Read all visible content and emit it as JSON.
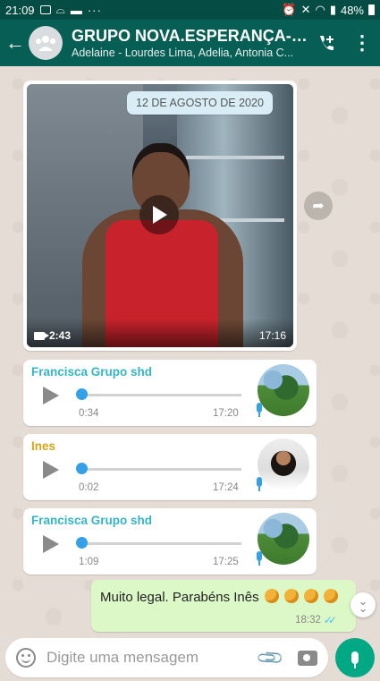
{
  "statusbar": {
    "time": "21:09",
    "more": "···",
    "battery": "48%"
  },
  "header": {
    "back_glyph": "←",
    "title": "GRUPO NOVA.ESPERANÇA- S...",
    "subtitle": "Adelaine - Lourdes Lima, Adelia, Antonia C...",
    "icons": [
      "back-arrow-icon",
      "group-avatar-icon",
      "add-call-icon",
      "more-vert-icon"
    ]
  },
  "chat": {
    "date_chip": "12 DE AGOSTO DE 2020",
    "video": {
      "duration": "2:43",
      "time": "17:16"
    },
    "audio_messages": [
      {
        "sender": "Francisca Grupo shd",
        "sender_color": "#35b5c8",
        "duration": "0:34",
        "time": "17:20",
        "avatar": "trees"
      },
      {
        "sender": "Ines",
        "sender_color": "#d8a41a",
        "duration": "0:02",
        "time": "17:24",
        "avatar": "woman"
      },
      {
        "sender": "Francisca Grupo shd",
        "sender_color": "#35b5c8",
        "duration": "1:09",
        "time": "17:25",
        "avatar": "trees"
      }
    ],
    "outgoing": {
      "text": "Muito legal. Parabéns Inês",
      "time": "18:32",
      "emoji": "clapping-hands"
    }
  },
  "composer": {
    "placeholder": "Digite uma mensagem"
  },
  "colors": {
    "header": "#075e54",
    "statusbar": "#054d44",
    "outgoing_bubble": "#dcf8c6",
    "accent": "#00a884",
    "audio_progress": "#34a0e8"
  }
}
